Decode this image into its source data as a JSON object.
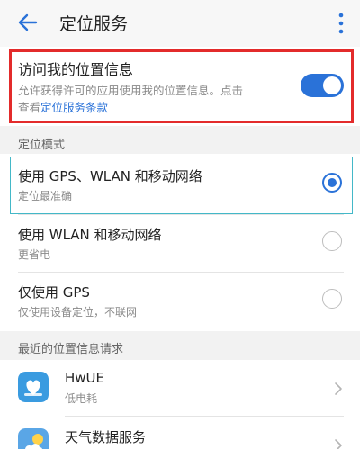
{
  "header": {
    "title": "定位服务"
  },
  "location_access": {
    "title": "访问我的位置信息",
    "desc_line1": "允许获得许可的应用使用我的位置信息。点击",
    "desc_prefix": "查看",
    "link": "定位服务条款",
    "enabled": true
  },
  "mode_section": {
    "header": "定位模式",
    "options": [
      {
        "title": "使用 GPS、WLAN 和移动网络",
        "subtitle": "定位最准确",
        "selected": true
      },
      {
        "title": "使用 WLAN 和移动网络",
        "subtitle": "更省电",
        "selected": false
      },
      {
        "title": "仅使用 GPS",
        "subtitle": "仅使用设备定位，不联网",
        "selected": false
      }
    ]
  },
  "recent_section": {
    "header": "最近的位置信息请求",
    "apps": [
      {
        "name": "HwUE",
        "subtitle": "低电耗",
        "icon": "hwue-heart-icon"
      },
      {
        "name": "天气数据服务",
        "subtitle": "",
        "icon": "weather-app-icon"
      }
    ]
  },
  "colors": {
    "accent": "#2a72d8",
    "highlight_frame": "#e32b2b",
    "selected_border": "#43b8c8"
  }
}
